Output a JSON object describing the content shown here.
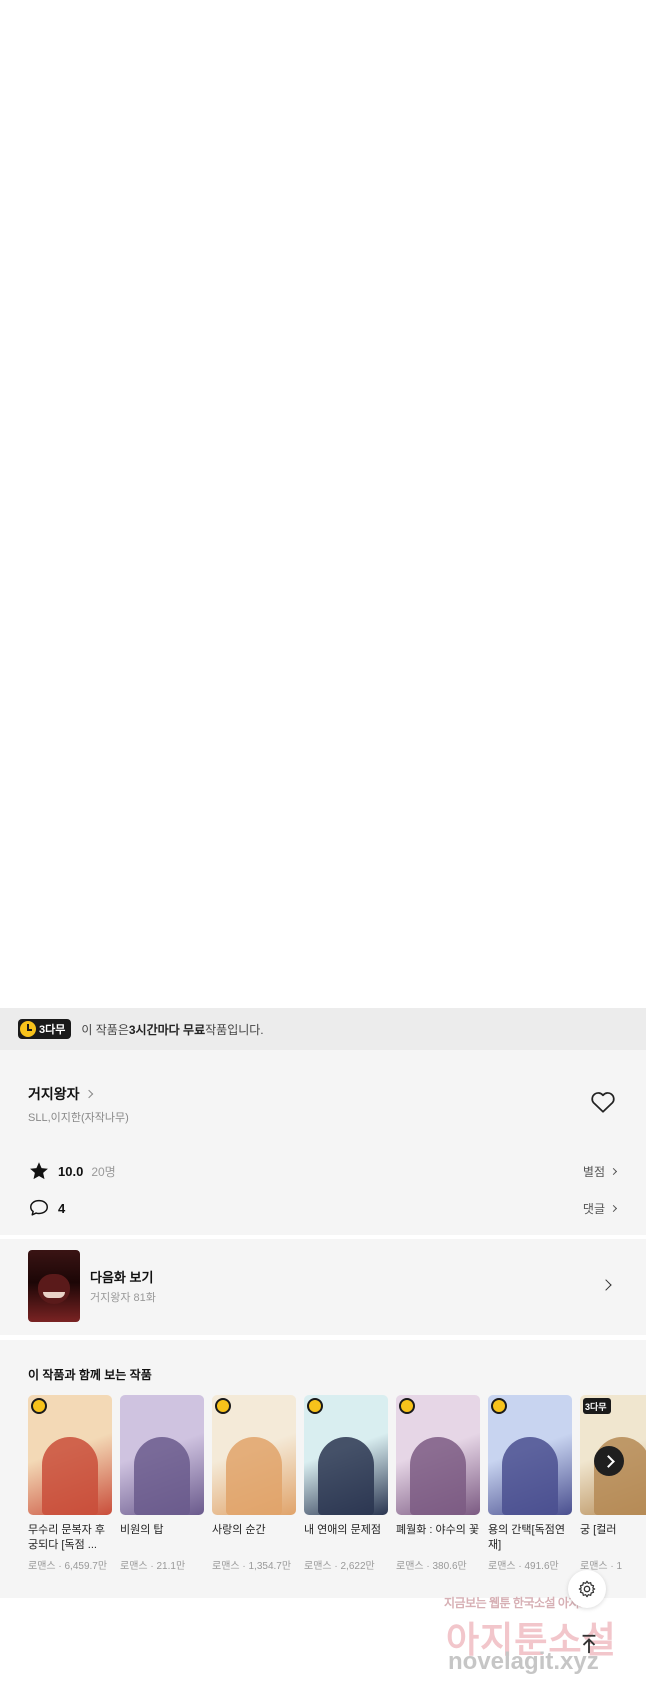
{
  "notice": {
    "badge": "3다무",
    "text_before": "이 작품은 ",
    "text_bold": "3시간마다 무료",
    "text_after": " 작품입니다."
  },
  "work": {
    "title": "거지왕자",
    "author": "SLL,이지한(자작나무)",
    "rating": "10.0",
    "rating_count": "20명",
    "rating_link": "별점",
    "comment_count": "4",
    "comment_link": "댓글"
  },
  "next_episode": {
    "title": "다음화 보기",
    "subtitle": "거지왕자 81화"
  },
  "recommendations": {
    "title": "이 작품과 함께 보는 작품",
    "items": [
      {
        "name": "무수리 문복자 후궁되다 [독점 ...",
        "genre": "로맨스",
        "views": "6,459.7만",
        "color_a": "#f3d9b6",
        "color_b": "#c94d3a",
        "badge": "clock"
      },
      {
        "name": "비원의 탑",
        "genre": "로맨스",
        "views": "21.1만",
        "color_a": "#cfc3e0",
        "color_b": "#6a5a8c",
        "badge": "none"
      },
      {
        "name": "사랑의 순간",
        "genre": "로맨스",
        "views": "1,354.7만",
        "color_a": "#f4ead8",
        "color_b": "#e0a36a",
        "badge": "clock"
      },
      {
        "name": "내 연애의 문제점",
        "genre": "로맨스",
        "views": "2,622만",
        "color_a": "#d9eef0",
        "color_b": "#2a3550",
        "badge": "clock"
      },
      {
        "name": "폐월화 : 야수의 꽃",
        "genre": "로맨스",
        "views": "380.6만",
        "color_a": "#e6d6e6",
        "color_b": "#7b5a82",
        "badge": "clock"
      },
      {
        "name": "용의 간택[독점연재]",
        "genre": "로맨스",
        "views": "491.6만",
        "color_a": "#c8d4f0",
        "color_b": "#4a4f8f",
        "badge": "clock"
      },
      {
        "name": "궁 [컬러",
        "genre": "로맨스",
        "views": "1",
        "color_a": "#f0e6cf",
        "color_b": "#b58a55",
        "badge": "3다무"
      }
    ]
  },
  "watermark": {
    "line1": "지금보는 웹툰 한국소설 아지토",
    "line2": "아지툰소설",
    "line3": "novelagit.xyz"
  }
}
